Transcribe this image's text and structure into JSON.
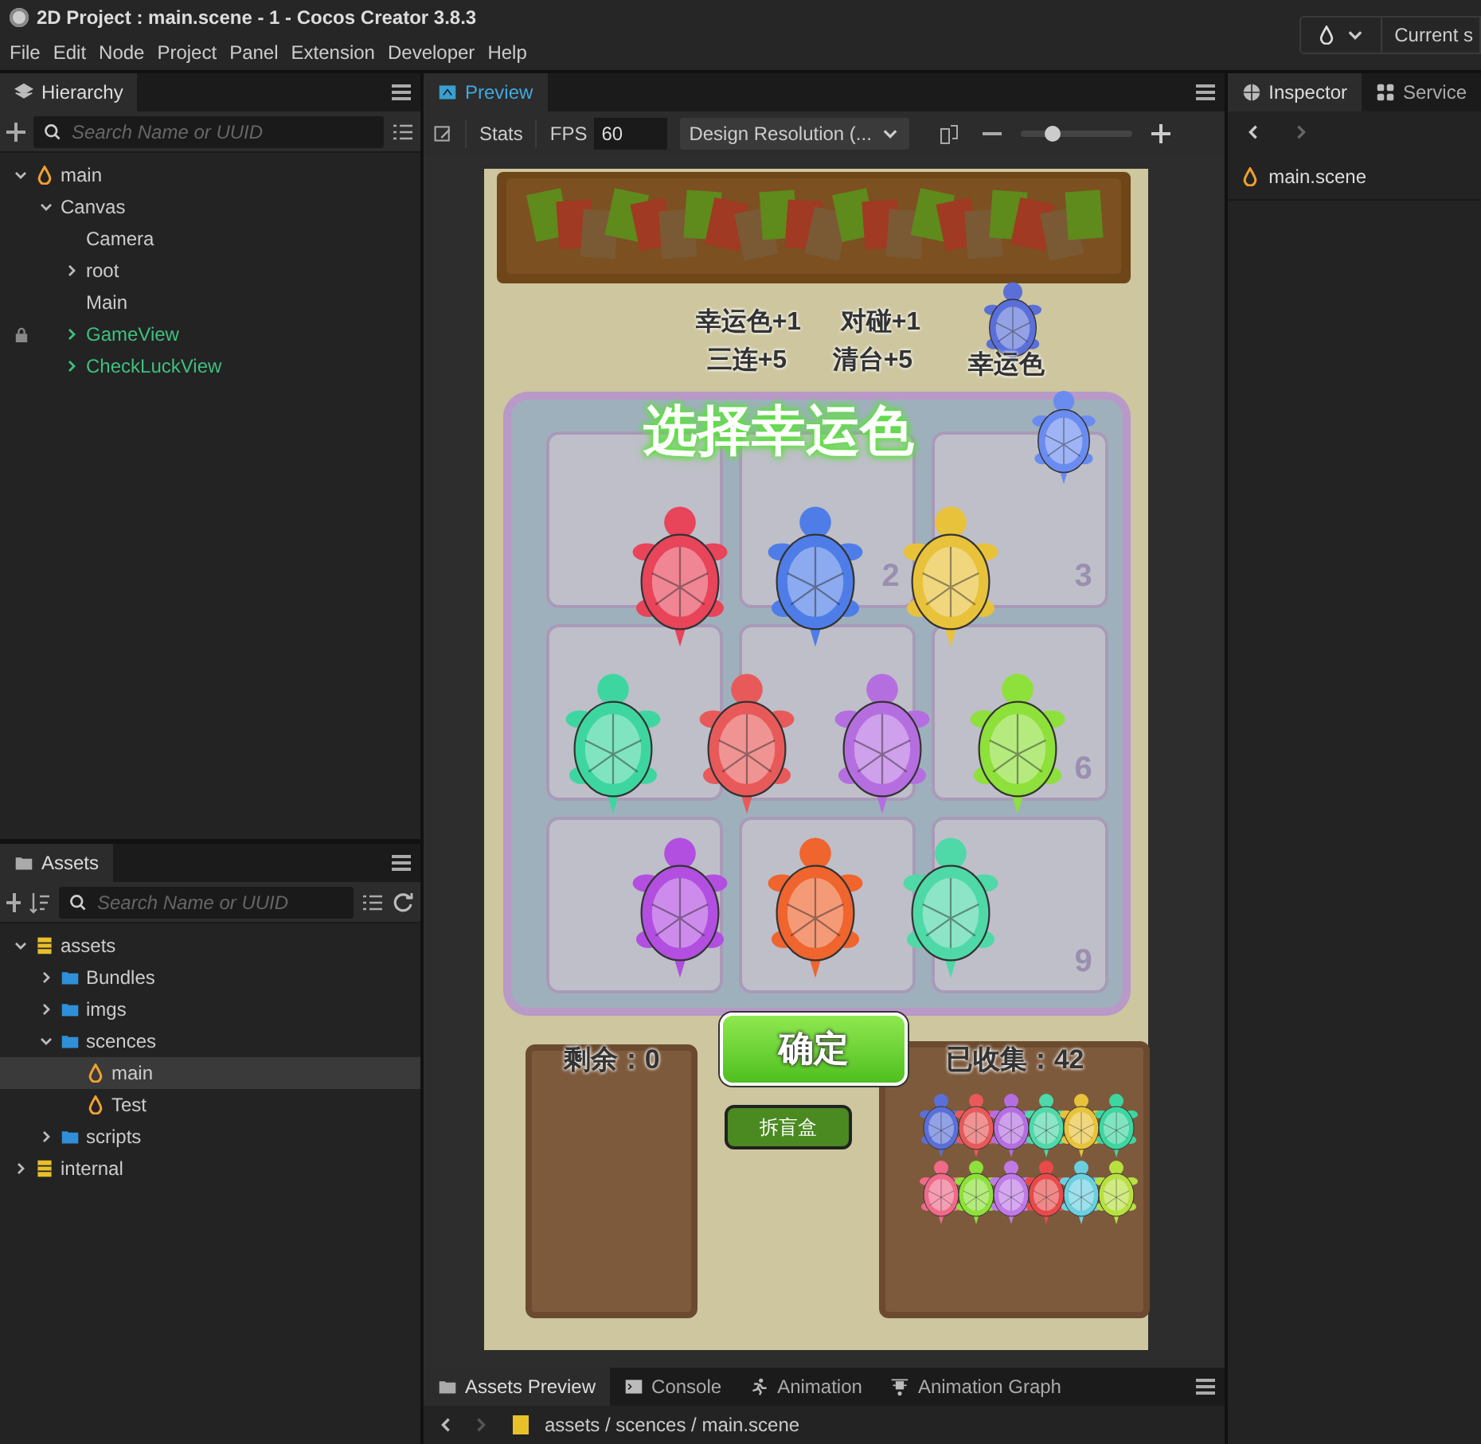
{
  "window": {
    "title": "2D Project : main.scene - 1 - Cocos Creator 3.8.3"
  },
  "menu": [
    "File",
    "Edit",
    "Node",
    "Project",
    "Panel",
    "Extension",
    "Developer",
    "Help"
  ],
  "top_right": {
    "label": "Current s"
  },
  "hierarchy": {
    "tab": "Hierarchy",
    "search": {
      "placeholder": "Search Name or UUID"
    },
    "tree": [
      {
        "label": "main",
        "kind": "scene",
        "expanded": true,
        "children": [
          {
            "label": "Canvas",
            "kind": "node",
            "expanded": true,
            "children": [
              {
                "label": "Camera",
                "kind": "node"
              },
              {
                "label": "root",
                "kind": "node",
                "expanded": false
              },
              {
                "label": "Main",
                "kind": "node"
              },
              {
                "label": "GameView",
                "kind": "prefab",
                "locked": true,
                "expanded": false
              },
              {
                "label": "CheckLuckView",
                "kind": "prefab",
                "expanded": false
              }
            ]
          }
        ]
      }
    ]
  },
  "assets": {
    "tab": "Assets",
    "search": {
      "placeholder": "Search Name or UUID"
    },
    "tree": [
      {
        "label": "assets",
        "kind": "db",
        "expanded": true,
        "selected": false,
        "children": [
          {
            "label": "Bundles",
            "kind": "folder",
            "expanded": false,
            "selected": false
          },
          {
            "label": "imgs",
            "kind": "folder",
            "expanded": false,
            "selected": false
          },
          {
            "label": "scences",
            "kind": "folder",
            "expanded": true,
            "selected": false,
            "children": [
              {
                "label": "main",
                "kind": "scene",
                "selected": true
              },
              {
                "label": "Test",
                "kind": "scene",
                "selected": false
              }
            ]
          },
          {
            "label": "scripts",
            "kind": "folder",
            "expanded": false,
            "selected": false
          }
        ]
      },
      {
        "label": "internal",
        "kind": "db",
        "expanded": false,
        "selected": false
      }
    ]
  },
  "preview": {
    "tab": "Preview",
    "stats": "Stats",
    "fps_label": "FPS",
    "fps": "60",
    "resolution": "Design Resolution (...",
    "zoom": {
      "level": 0.28
    }
  },
  "game": {
    "score_rules": [
      "幸运色+1",
      "对碰+1",
      "三连+5",
      "清台+5"
    ],
    "lucky": {
      "label": "幸运色",
      "color": "#5a6fd8"
    },
    "title": "选择幸运色",
    "title_turtle": {
      "color": "#6a8cf0"
    },
    "cells": [
      {},
      {
        "number": "2"
      },
      {
        "number": "3"
      },
      {},
      {},
      {
        "number": "6"
      },
      {},
      {},
      {
        "number": "9"
      }
    ],
    "turtles": [
      {
        "color": "#e8445a"
      },
      {
        "color": "#4f7de8"
      },
      {
        "color": "#e8c23a"
      },
      {
        "color": "#3ed6a0"
      },
      {
        "color": "#e85a5a"
      },
      {
        "color": "#b56ee0"
      },
      {
        "color": "#8ee03a"
      },
      {
        "color": "#b24fe0"
      },
      {
        "color": "#f0642e"
      },
      {
        "color": "#4fd8a8"
      }
    ],
    "remaining": "剩余：0",
    "confirm": "确定",
    "open_box": "拆盲盒",
    "collected": "已收集：42"
  },
  "inspector": {
    "tabs": [
      {
        "label": "Inspector",
        "selected": true
      },
      {
        "label": "Service",
        "selected": false
      }
    ],
    "item": "main.scene"
  },
  "bottom": {
    "tabs": [
      {
        "label": "Assets Preview",
        "selected": true
      },
      {
        "label": "Console",
        "selected": false
      },
      {
        "label": "Animation",
        "selected": false
      },
      {
        "label": "Animation Graph",
        "selected": false
      }
    ],
    "path": "assets / scences / main.scene"
  }
}
